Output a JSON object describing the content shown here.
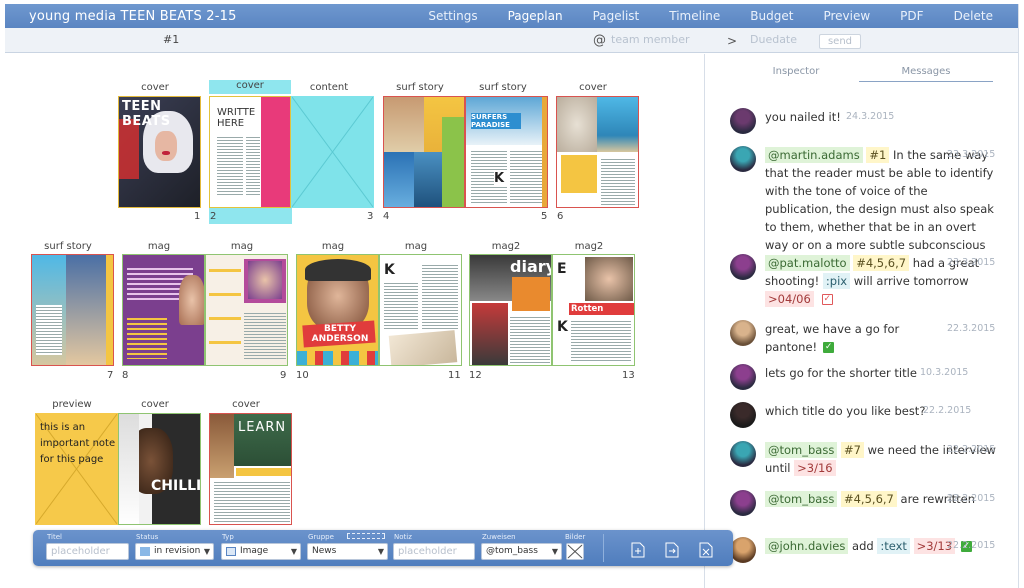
{
  "app": {
    "title": "young media TEEN BEATS 2-15"
  },
  "nav": [
    {
      "label": "Settings"
    },
    {
      "label": "Pageplan",
      "active": true
    },
    {
      "label": "Pagelist"
    },
    {
      "label": "Timeline"
    },
    {
      "label": "Budget"
    },
    {
      "label": "Preview"
    },
    {
      "label": "PDF"
    },
    {
      "label": "Delete"
    }
  ],
  "subbar": {
    "issue": "#1",
    "at": "@",
    "team_placeholder": "team member",
    "gt": ">",
    "due_placeholder": "Duedate",
    "send_label": "send"
  },
  "pages": {
    "labels": [
      "cover",
      "cover",
      "content",
      "surf story",
      "surf story",
      "cover",
      "surf story",
      "mag",
      "mag",
      "mag",
      "mag",
      "mag2",
      "mag2",
      "preview",
      "cover",
      "cover"
    ],
    "numbers": [
      "1",
      "2",
      "3",
      "4",
      "5",
      "6",
      "7",
      "8",
      "9",
      "10",
      "11",
      "12",
      "13"
    ],
    "cover1_text": "TEEN BEATS",
    "page2_text": "WRITTE HERE",
    "surf_title": "SURFERS PARADISE",
    "betty_text": "BETTY ANDERSON",
    "rotten_text": "Rotten Onion",
    "learn_text": "LEARN",
    "chilli_text": "CHILLI",
    "preview_note": "this is an important note for this page"
  },
  "sidebar": {
    "tabs": [
      {
        "label": "Inspector"
      },
      {
        "label": "Messages",
        "active": true
      }
    ],
    "messages": [
      {
        "text": "you nailed it!",
        "date": "24.3.2015"
      },
      {
        "user": "@martin.adams",
        "num": "#1",
        "text": "In the same way that the reader must be able to identify with the tone of voice of the publication, the design must also speak to them, whether that be in an overt way or on a more subtle subconscious level.",
        "date": "23.3.2015"
      },
      {
        "user": "@pat.malotto",
        "num": "#4,5,6,7",
        "text1": "had a great shooting!",
        "type": ":pix",
        "text2": "will arrive tomorrow",
        "due": ">04/06",
        "date": "23.3.2015"
      },
      {
        "text": "great, we have a go for pantone!",
        "date": "22.3.2015"
      },
      {
        "text": "lets go for the shorter title",
        "date": "10.3.2015"
      },
      {
        "text": "which title do you like best?",
        "date": "22.2.2015"
      },
      {
        "user": "@tom_bass",
        "num": "#7",
        "text": "we need the interview until",
        "due": ">3/16",
        "date": "22.2.2015"
      },
      {
        "user": "@tom_bass",
        "num": "#4,5,6,7",
        "text": "are rewritten",
        "date": "22.2.2015"
      },
      {
        "user": "@john.davies",
        "text": "add",
        "type": ":text",
        "due": ">3/13",
        "date": "22.2.2015"
      }
    ]
  },
  "bottom": {
    "title_label": "Titel",
    "title_placeholder": "placeholder",
    "status_label": "Status",
    "status_value": "in revision",
    "type_label": "Typ",
    "type_value": "Image",
    "group_label": "Gruppe",
    "group_value": "News",
    "note_label": "Notiz",
    "note_placeholder": "placeholder",
    "assign_label": "Zuweisen",
    "assign_value": "@tom_bass",
    "images_label": "Bilder"
  },
  "colors": {
    "accent": "#5a85c2",
    "cyan": "#7fe3ea",
    "yellow": "#f6c94a",
    "red_border": "#d9534f",
    "green_border": "#8fc471"
  }
}
